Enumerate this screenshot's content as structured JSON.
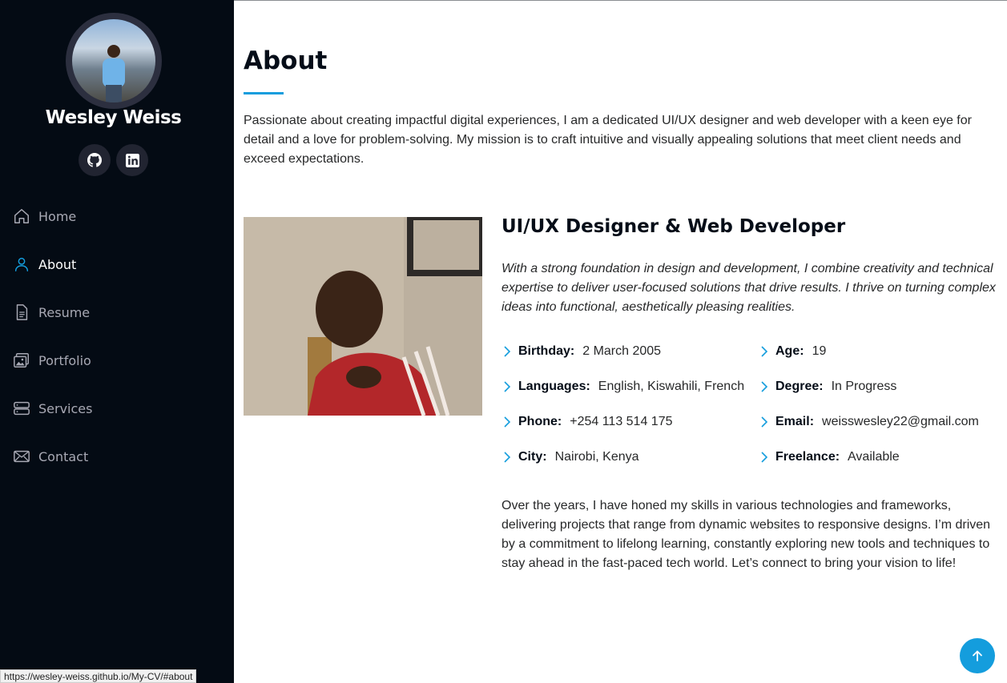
{
  "profile": {
    "name": "Wesley Weiss"
  },
  "social": [
    {
      "icon": "github-icon"
    },
    {
      "icon": "linkedin-icon"
    }
  ],
  "nav": {
    "items": [
      {
        "label": "Home",
        "icon": "home-icon"
      },
      {
        "label": "About",
        "icon": "person-icon"
      },
      {
        "label": "Resume",
        "icon": "file-icon"
      },
      {
        "label": "Portfolio",
        "icon": "images-icon"
      },
      {
        "label": "Services",
        "icon": "server-icon"
      },
      {
        "label": "Contact",
        "icon": "envelope-icon"
      }
    ],
    "active": "About"
  },
  "about": {
    "title": "About",
    "intro": "Passionate about creating impactful digital experiences, I am a dedicated UI/UX designer and web developer with a keen eye for detail and a love for problem-solving. My mission is to craft intuitive and visually appealing solutions that meet client needs and exceed expectations.",
    "subtitle": "UI/UX Designer & Web Developer",
    "lead": "With a strong foundation in design and development, I combine creativity and technical expertise to deliver user-focused solutions that drive results. I thrive on turning complex ideas into functional, aesthetically pleasing realities.",
    "facts": [
      {
        "label": "Birthday:",
        "value": "2 March 2005"
      },
      {
        "label": "Age:",
        "value": "19"
      },
      {
        "label": "Languages:",
        "value": "English, Kiswahili, French"
      },
      {
        "label": "Degree:",
        "value": "In Progress"
      },
      {
        "label": "Phone:",
        "value": "+254 113 514 175"
      },
      {
        "label": "Email:",
        "value": "weisswesley22@gmail.com"
      },
      {
        "label": "City:",
        "value": "Nairobi, Kenya"
      },
      {
        "label": "Freelance:",
        "value": "Available"
      }
    ],
    "outro": "Over the years, I have honed my skills in various technologies and frameworks, delivering projects that range from dynamic websites to responsive designs. I’m driven by a commitment to lifelong learning, constantly exploring new tools and techniques to stay ahead in the fast-paced tech world. Let’s connect to bring your vision to life!"
  },
  "status_url": "https://wesley-weiss.github.io/My-CV/#about",
  "colors": {
    "accent": "#149ddd",
    "sidebar_bg": "#040b14",
    "heading": "#050d18"
  }
}
